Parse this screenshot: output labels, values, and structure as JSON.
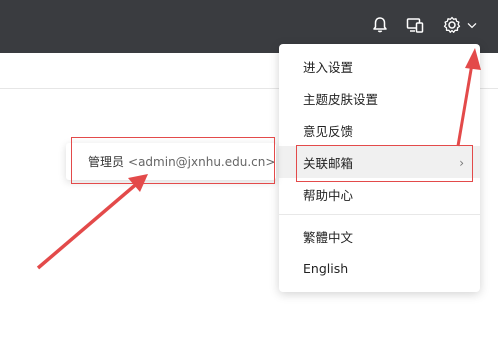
{
  "topbar": {
    "icons": [
      "bell-icon",
      "device-sync-icon",
      "gear-icon",
      "chevron-down-icon"
    ]
  },
  "settings_menu": {
    "items": [
      {
        "label": "进入设置"
      },
      {
        "label": "主题皮肤设置"
      },
      {
        "label": "意见反馈"
      },
      {
        "label": "关联邮箱"
      },
      {
        "label": "帮助中心"
      },
      {
        "label": "繁體中文"
      },
      {
        "label": "English"
      }
    ],
    "submenu_chevron": "›"
  },
  "linked_mailbox_submenu": {
    "account_name": "管理员",
    "account_email": "<admin@jxnhu.edu.cn>"
  },
  "colors": {
    "topbar_bg": "#3a3c40",
    "annotation_red": "#e34a4a"
  }
}
